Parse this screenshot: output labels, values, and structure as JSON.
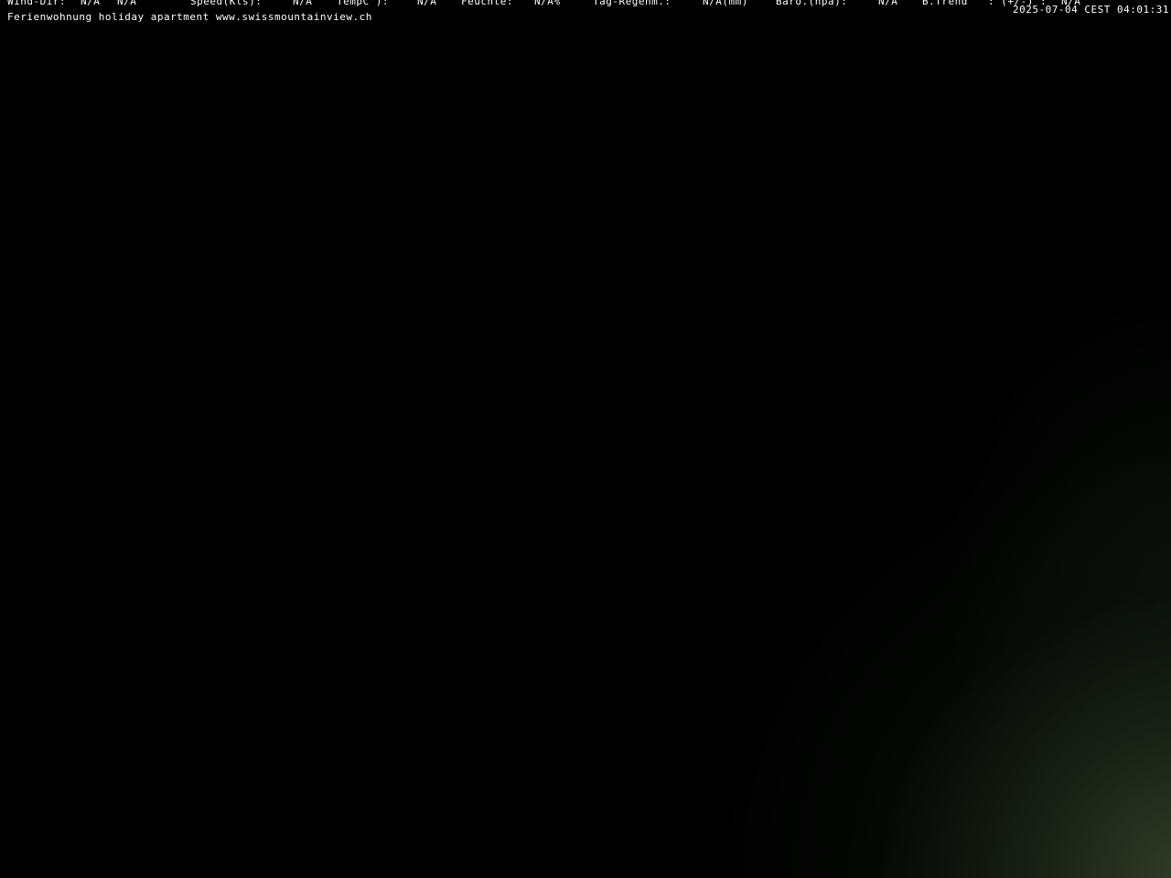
{
  "overlay": {
    "weather": {
      "wind_dir_label": "Wind-Dir:",
      "wind_dir_value": "N/A",
      "wind_deg_value": "N/A°",
      "speed_label": "Speed(Kts):",
      "speed_value": "N/A",
      "temp_label": "TempC°):",
      "temp_value": "N/A",
      "humidity_label": "Feuchte:",
      "humidity_value": "N/A%",
      "rain_label": "Tag-Regenm.:",
      "rain_value": "N/A(mm)",
      "baro_label": "Baro.(hpa):",
      "baro_value": "N/A",
      "trend_label": "B.Trend",
      "trend_sign": ": (+/-) :",
      "trend_value": "N/A"
    },
    "caption": "Ferienwohnung holiday apartment www.swissmountainview.ch",
    "timestamp": "2025-07-04 CEST 04:01:31"
  },
  "colors": {
    "text": "#ffffff",
    "background": "#000000",
    "glow": "#34402a"
  }
}
